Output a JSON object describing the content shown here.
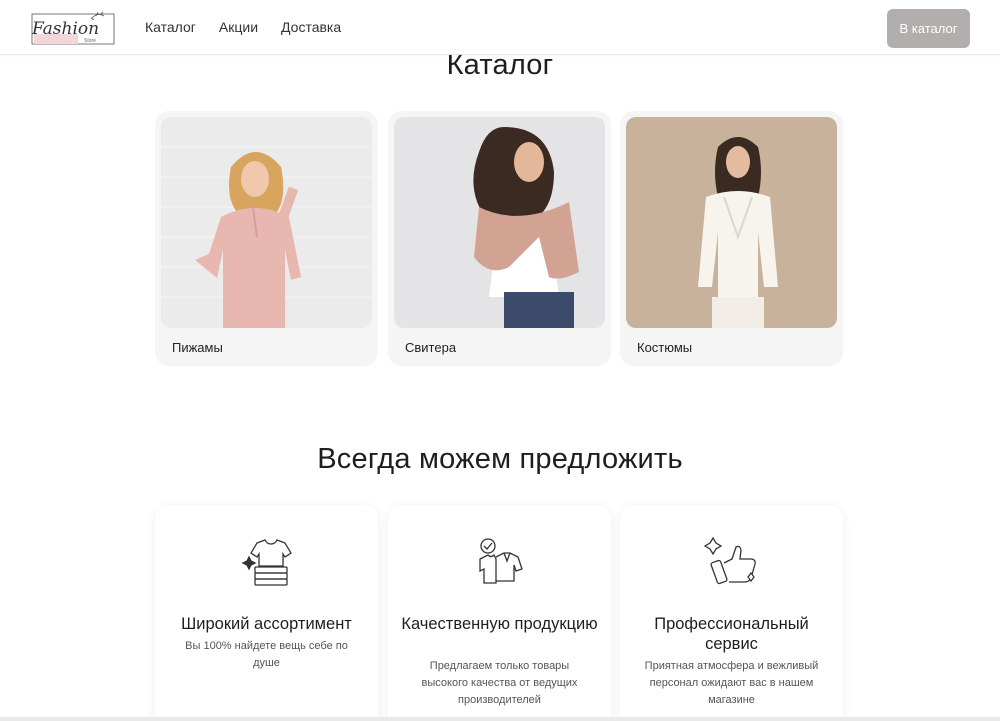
{
  "header": {
    "logo": {
      "text": "Fashion",
      "sub": "Store",
      "icon": "fashion-store-logo"
    },
    "nav": [
      "Каталог",
      "Акции",
      "Доставка"
    ],
    "cta_label": "В каталог",
    "cta_color": "#b3aeae"
  },
  "catalog": {
    "title": "Каталог",
    "items": [
      {
        "label": "Пижамы",
        "image": "woman-in-pink-pajamas"
      },
      {
        "label": "Свитера",
        "image": "woman-in-knit-sweater"
      },
      {
        "label": "Костюмы",
        "image": "woman-in-white-suit"
      }
    ]
  },
  "offer": {
    "title": "Всегда можем предложить",
    "items": [
      {
        "title": "Широкий ассортимент",
        "desc": "Вы 100% найдете вещь себе по душе",
        "icon": "clothes-stack-icon"
      },
      {
        "title": "Качественную продукцию",
        "desc": "Предлагаем только товары высокого качества от ведущих производителей",
        "icon": "quality-shirt-icon"
      },
      {
        "title": "Профессиональный сервис",
        "desc": "Приятная атмосфера и вежливый персонал ожидают вас в нашем магазине",
        "icon": "thumbs-up-icon"
      }
    ]
  }
}
